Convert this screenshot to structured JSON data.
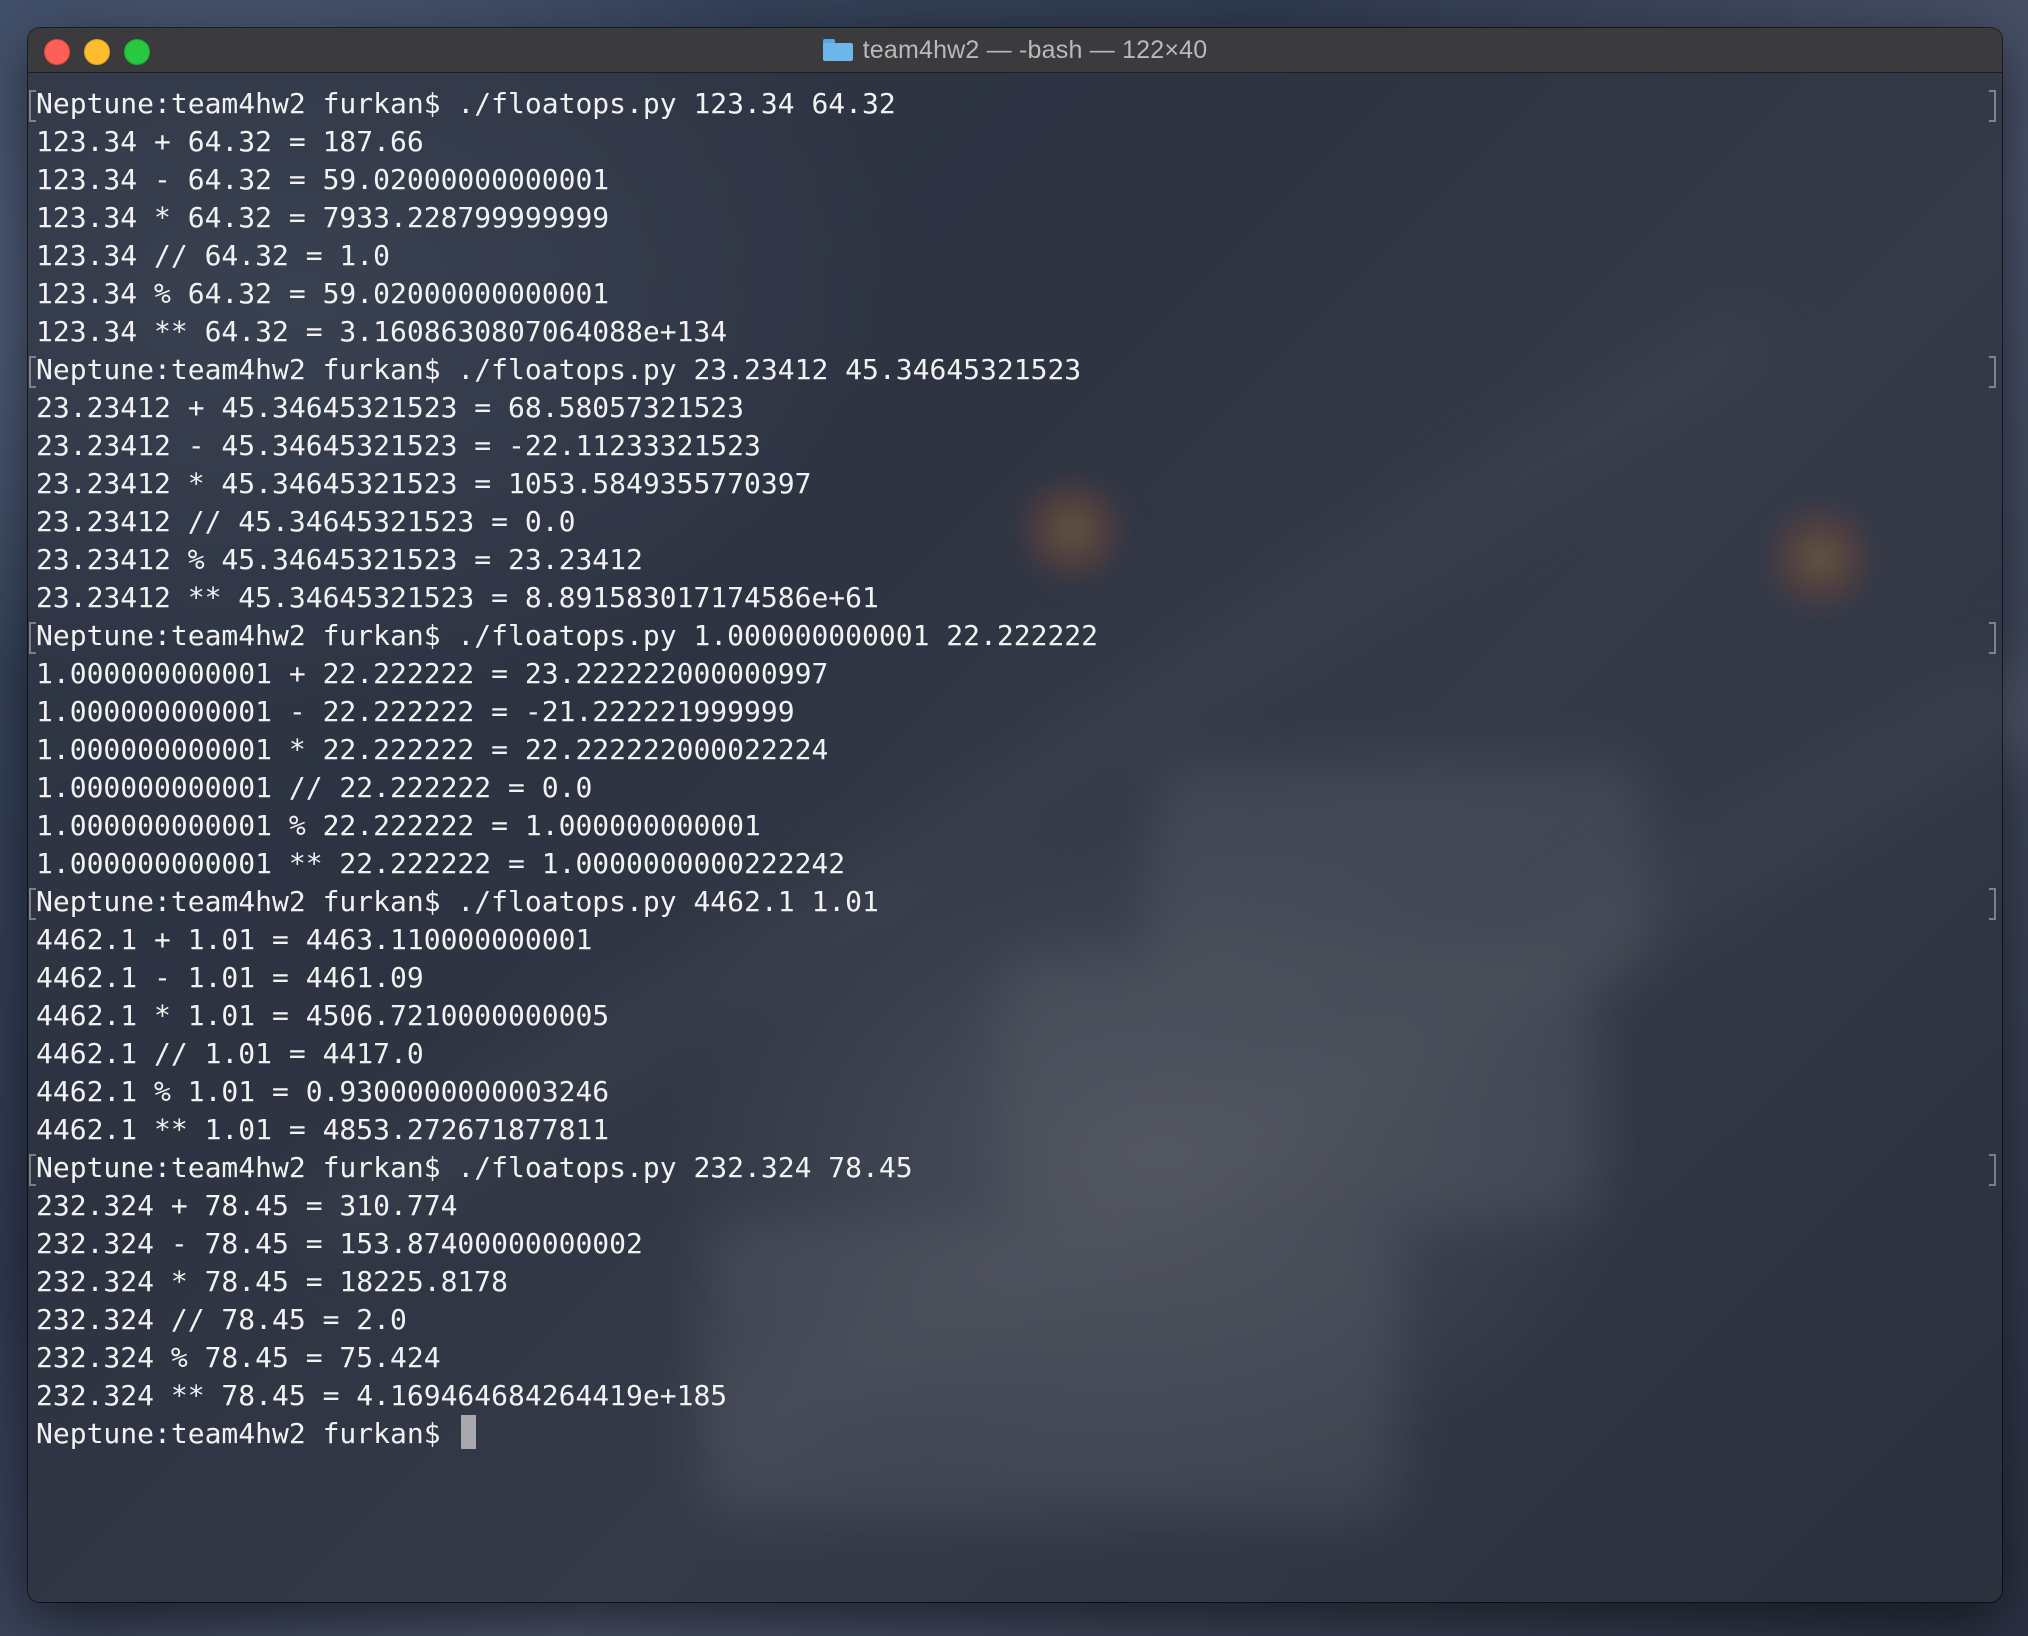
{
  "window": {
    "title": "team4hw2 — -bash — 122×40",
    "folder_icon": "folder-icon"
  },
  "terminal": {
    "lines": [
      {
        "type": "prompt",
        "text": "Neptune:team4hw2 furkan$ ./floatops.py 123.34 64.32"
      },
      {
        "type": "output",
        "text": "123.34 + 64.32 = 187.66"
      },
      {
        "type": "output",
        "text": "123.34 - 64.32 = 59.02000000000001"
      },
      {
        "type": "output",
        "text": "123.34 * 64.32 = 7933.228799999999"
      },
      {
        "type": "output",
        "text": "123.34 // 64.32 = 1.0"
      },
      {
        "type": "output",
        "text": "123.34 % 64.32 = 59.02000000000001"
      },
      {
        "type": "output",
        "text": "123.34 ** 64.32 = 3.1608630807064088e+134"
      },
      {
        "type": "prompt",
        "text": "Neptune:team4hw2 furkan$ ./floatops.py 23.23412 45.34645321523"
      },
      {
        "type": "output",
        "text": "23.23412 + 45.34645321523 = 68.58057321523"
      },
      {
        "type": "output",
        "text": "23.23412 - 45.34645321523 = -22.11233321523"
      },
      {
        "type": "output",
        "text": "23.23412 * 45.34645321523 = 1053.5849355770397"
      },
      {
        "type": "output",
        "text": "23.23412 // 45.34645321523 = 0.0"
      },
      {
        "type": "output",
        "text": "23.23412 % 45.34645321523 = 23.23412"
      },
      {
        "type": "output",
        "text": "23.23412 ** 45.34645321523 = 8.891583017174586e+61"
      },
      {
        "type": "prompt",
        "text": "Neptune:team4hw2 furkan$ ./floatops.py 1.000000000001 22.222222"
      },
      {
        "type": "output",
        "text": "1.000000000001 + 22.222222 = 23.222222000000997"
      },
      {
        "type": "output",
        "text": "1.000000000001 - 22.222222 = -21.222221999999"
      },
      {
        "type": "output",
        "text": "1.000000000001 * 22.222222 = 22.222222000022224"
      },
      {
        "type": "output",
        "text": "1.000000000001 // 22.222222 = 0.0"
      },
      {
        "type": "output",
        "text": "1.000000000001 % 22.222222 = 1.000000000001"
      },
      {
        "type": "output",
        "text": "1.000000000001 ** 22.222222 = 1.0000000000222242"
      },
      {
        "type": "prompt",
        "text": "Neptune:team4hw2 furkan$ ./floatops.py 4462.1 1.01"
      },
      {
        "type": "output",
        "text": "4462.1 + 1.01 = 4463.110000000001"
      },
      {
        "type": "output",
        "text": "4462.1 - 1.01 = 4461.09"
      },
      {
        "type": "output",
        "text": "4462.1 * 1.01 = 4506.7210000000005"
      },
      {
        "type": "output",
        "text": "4462.1 // 1.01 = 4417.0"
      },
      {
        "type": "output",
        "text": "4462.1 % 1.01 = 0.9300000000003246"
      },
      {
        "type": "output",
        "text": "4462.1 ** 1.01 = 4853.272671877811"
      },
      {
        "type": "prompt",
        "text": "Neptune:team4hw2 furkan$ ./floatops.py 232.324 78.45"
      },
      {
        "type": "output",
        "text": "232.324 + 78.45 = 310.774"
      },
      {
        "type": "output",
        "text": "232.324 - 78.45 = 153.87400000000002"
      },
      {
        "type": "output",
        "text": "232.324 * 78.45 = 18225.8178"
      },
      {
        "type": "output",
        "text": "232.324 // 78.45 = 2.0"
      },
      {
        "type": "output",
        "text": "232.324 % 78.45 = 75.424"
      },
      {
        "type": "output",
        "text": "232.324 ** 78.45 = 4.169464684264419e+185"
      }
    ],
    "current_prompt": "Neptune:team4hw2 furkan$ ",
    "cursor_icon": "block-cursor-icon"
  },
  "colors": {
    "text": "#f2f2f2",
    "close": "#fe5f57",
    "minimize": "#febc2e",
    "zoom": "#28c840",
    "titlebar": "#3b3b3d"
  }
}
